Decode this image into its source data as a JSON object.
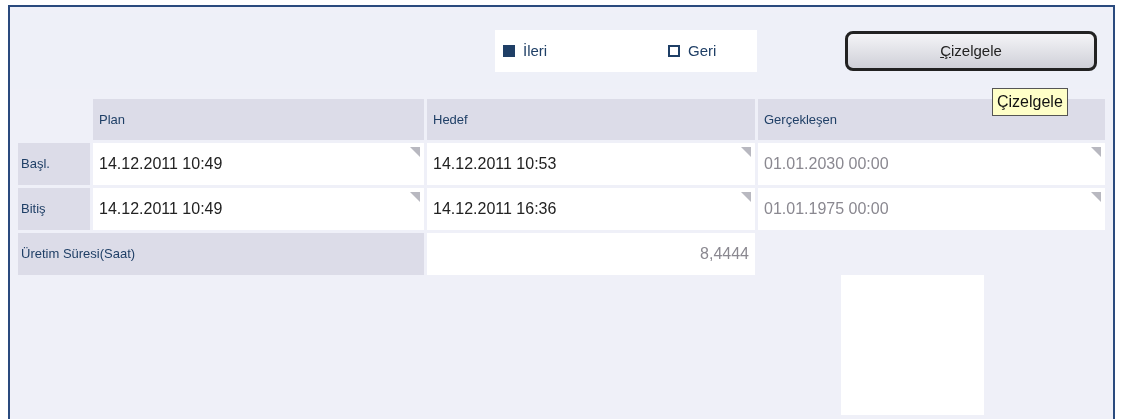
{
  "direction_options": [
    {
      "label": "İleri",
      "selected": true
    },
    {
      "label": "Geri",
      "selected": false
    }
  ],
  "schedule_button": {
    "label": "Çizelgele"
  },
  "tooltip": {
    "text": "Çizelgele"
  },
  "table": {
    "columns": [
      "Plan",
      "Hedef",
      "Gerçekleşen"
    ],
    "rows": [
      {
        "label": "Başl.",
        "cells": [
          {
            "value": "14.12.2011 10:49",
            "disabled": false
          },
          {
            "value": "14.12.2011 10:53",
            "disabled": false
          },
          {
            "value": "01.01.2030 00:00",
            "disabled": true
          }
        ]
      },
      {
        "label": "Bitiş",
        "cells": [
          {
            "value": "14.12.2011 10:49",
            "disabled": false
          },
          {
            "value": "14.12.2011 16:36",
            "disabled": false
          },
          {
            "value": "01.01.1975 00:00",
            "disabled": true
          }
        ]
      }
    ]
  },
  "duration": {
    "label": "Üretim Süresi(Saat)",
    "value": "8,4444"
  }
}
